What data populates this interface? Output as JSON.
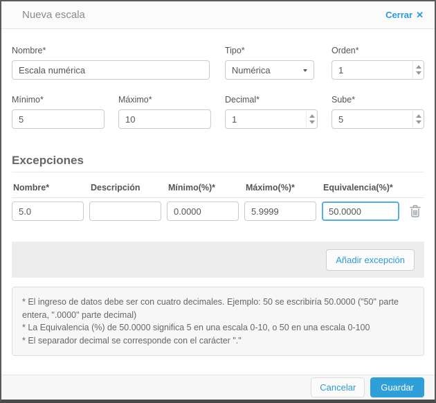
{
  "modal": {
    "title": "Nueva escala",
    "close_label": "Cerrar",
    "close_icon": "✕"
  },
  "fields": {
    "nombre": {
      "label": "Nombre*",
      "value": "Escala numérica"
    },
    "tipo": {
      "label": "Tipo*",
      "value": "Numérica"
    },
    "orden": {
      "label": "Orden*",
      "value": "1"
    },
    "minimo": {
      "label": "Mínimo*",
      "value": "5"
    },
    "maximo": {
      "label": "Máximo*",
      "value": "10"
    },
    "decimal": {
      "label": "Decimal*",
      "value": "1"
    },
    "sube": {
      "label": "Sube*",
      "value": "5"
    }
  },
  "exceptions": {
    "section_title": "Excepciones",
    "columns": [
      "Nombre*",
      "Descripción",
      "Mínimo(%)*",
      "Máximo(%)*",
      "Equivalencia(%)*"
    ],
    "rows": [
      {
        "nombre": "5.0",
        "descripcion": "",
        "minimo": "0.0000",
        "maximo": "5.9999",
        "equivalencia": "50.0000"
      }
    ],
    "add_button_label": "Añadir excepción"
  },
  "notes": [
    "* El ingreso de datos debe ser con cuatro decimales. Ejemplo: 50 se escribiría 50.0000 (\"50\" parte entera, \".0000\" parte decimal)",
    "* La Equivalencia (%) de 50.0000 significa 5 en una escala 0-10, o 50 en una escala 0-100",
    "* El separador decimal se corresponde con el carácter \".\""
  ],
  "footer": {
    "cancel_label": "Cancelar",
    "save_label": "Guardar"
  },
  "colors": {
    "accent_blue": "#2e9fd9",
    "link_blue": "#2b99d6",
    "focus_border": "#54aee1"
  }
}
